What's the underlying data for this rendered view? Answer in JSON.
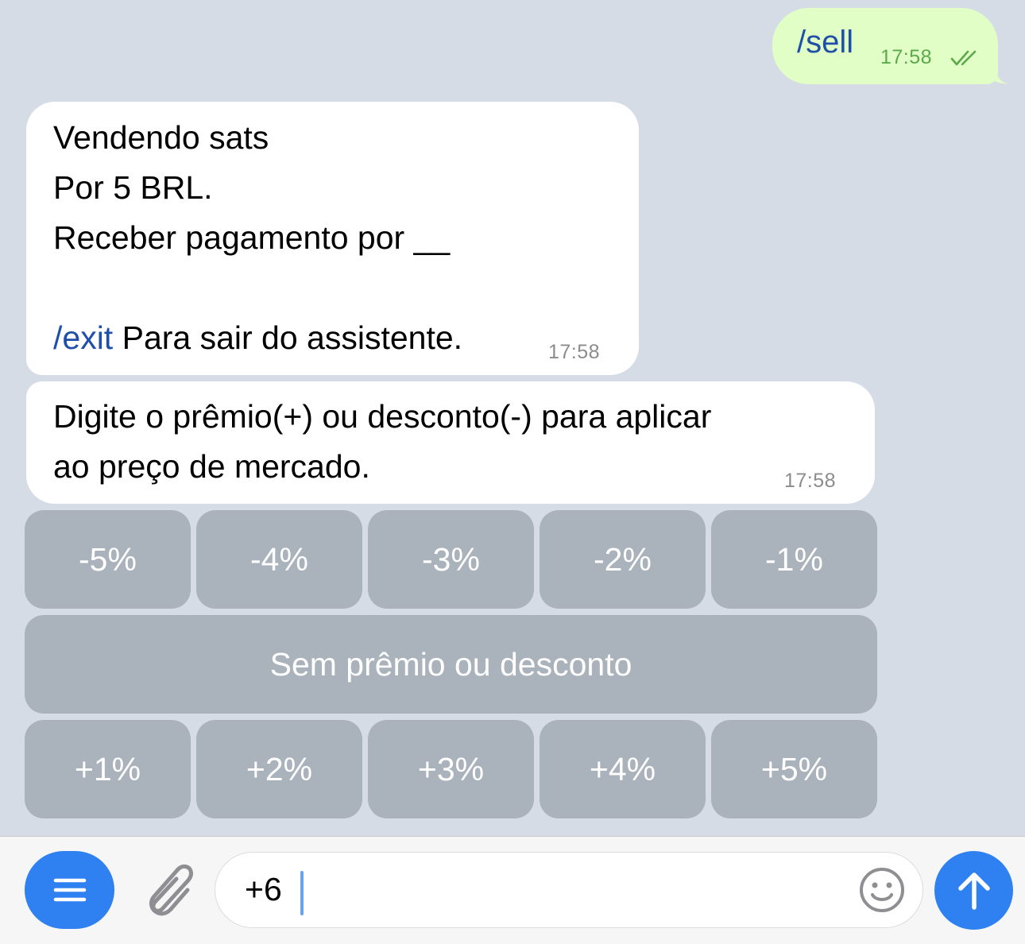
{
  "messages": {
    "outgoing": {
      "text": "/sell",
      "time": "17:58",
      "status_icon": "double-check-icon"
    },
    "incoming": [
      {
        "lines": [
          "Vendendo sats",
          "Por 5 BRL.",
          "Receber pagamento por __",
          ""
        ],
        "command": "/exit",
        "command_suffix": " Para sair do assistente.",
        "time": "17:58"
      },
      {
        "lines": [
          "Digite o prêmio(+) ou desconto(-) para aplicar",
          "ao preço de mercado."
        ],
        "time": "17:58"
      }
    ]
  },
  "keyboard": {
    "row1": [
      "-5%",
      "-4%",
      "-3%",
      "-2%",
      "-1%"
    ],
    "row2": [
      "Sem prêmio ou desconto"
    ],
    "row3": [
      "+1%",
      "+2%",
      "+3%",
      "+4%",
      "+5%"
    ]
  },
  "input": {
    "value": "+6",
    "menu_icon": "menu-icon",
    "attach_icon": "paperclip-icon",
    "emoji_icon": "emoji-icon",
    "send_icon": "arrow-up-icon"
  },
  "colors": {
    "background": "#d5dce6",
    "outgoing_bubble": "#e1fec6",
    "incoming_bubble": "#ffffff",
    "keyboard_button": "#aab2bb",
    "accent": "#2f80f0",
    "link": "#1f4fa8",
    "outgoing_time": "#5ca94a"
  }
}
